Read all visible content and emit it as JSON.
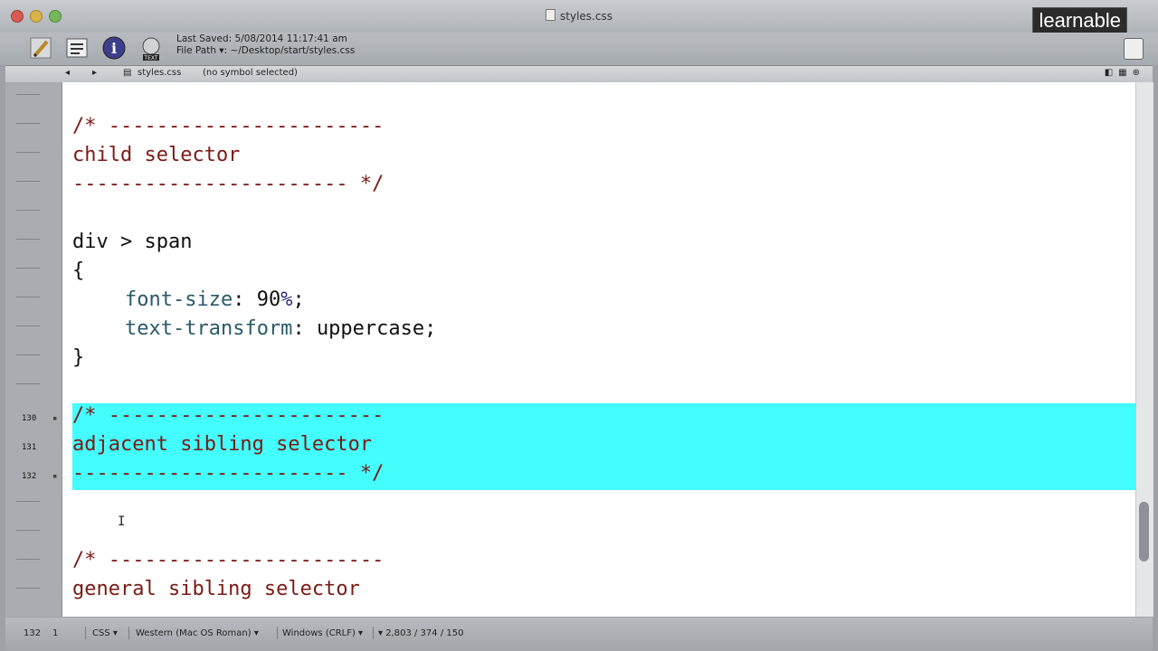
{
  "window": {
    "title": "styles.css",
    "brand": "learnable"
  },
  "toolbar": {
    "last_saved": "Last Saved: 5/08/2014 11:17:41 am",
    "file_path": "File Path ▾: ~/Desktop/start/styles.css",
    "text_icon_label": "TEXT"
  },
  "navbar": {
    "back": "◂",
    "forward": "▸",
    "file": "styles.css",
    "symbol": "(no symbol selected)"
  },
  "gutter": {
    "numbers": [
      "",
      "",
      "",
      "",
      "",
      "",
      "",
      "",
      "",
      "",
      "",
      "130",
      "131",
      "132",
      "",
      "",
      "",
      "",
      ""
    ]
  },
  "editor": {
    "lines": {
      "c1_open": "/* -----------------------",
      "c1_title": "child selector",
      "c1_close": "----------------------- */",
      "sel": "div > span",
      "open_brace": "{",
      "p1_name": "font-size",
      "p1_colon": ": ",
      "p1_num": "90",
      "p1_unit": "%",
      "p1_end": ";",
      "p2_name": "text-transform",
      "p2_colon": ": ",
      "p2_value": "uppercase;",
      "close_brace": "}",
      "c2_open": "/* -----------------------",
      "c2_title": "adjacent sibling selector",
      "c2_close": "----------------------- */",
      "c3_open": "/* -----------------------",
      "c3_title": "general sibling selector"
    },
    "ibeam": "I"
  },
  "statusbar": {
    "line": "132",
    "col": "1",
    "language": "CSS ▾",
    "encoding": "Western (Mac OS Roman) ▾",
    "line_endings": "Windows (CRLF) ▾",
    "stats": "▾ 2,803 / 374 / 150"
  },
  "colors": {
    "highlight": "#44fdfd",
    "comment": "#7a1a14",
    "property": "#2a5a6a"
  }
}
